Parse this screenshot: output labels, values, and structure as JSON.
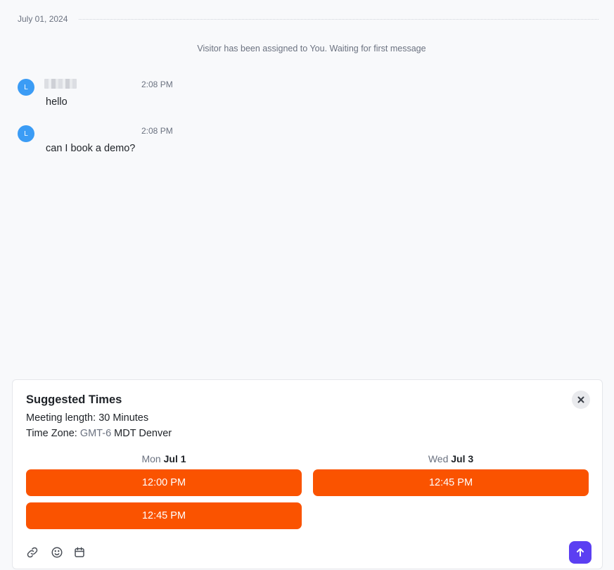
{
  "conversation": {
    "date_divider": "July 01, 2024",
    "system_message": "Visitor has been assigned to You. Waiting for first message",
    "messages": [
      {
        "avatar_initial": "L",
        "time": "2:08 PM",
        "text": "hello"
      },
      {
        "avatar_initial": "L",
        "time": "2:08 PM",
        "text": "can I book a demo?"
      }
    ]
  },
  "suggested_times": {
    "title": "Suggested Times",
    "meeting_length_label": "Meeting length:",
    "meeting_length_value": "30 Minutes",
    "timezone_label": "Time Zone:",
    "timezone_offset": "GMT-6",
    "timezone_name": "MDT Denver",
    "days": [
      {
        "day_name": "Mon",
        "date": "Jul 1",
        "slots": [
          "12:00 PM",
          "12:45 PM"
        ]
      },
      {
        "day_name": "Wed",
        "date": "Jul 3",
        "slots": [
          "12:45 PM"
        ]
      }
    ]
  },
  "composer": {
    "icons": [
      "link-icon",
      "emoji-icon",
      "calendar-icon",
      "send-arrow-up-icon"
    ]
  },
  "colors": {
    "slot_button": "#fa5300",
    "send_button": "#5b3ff2",
    "avatar": "#3b9cf5",
    "background": "#f8f9fb"
  }
}
